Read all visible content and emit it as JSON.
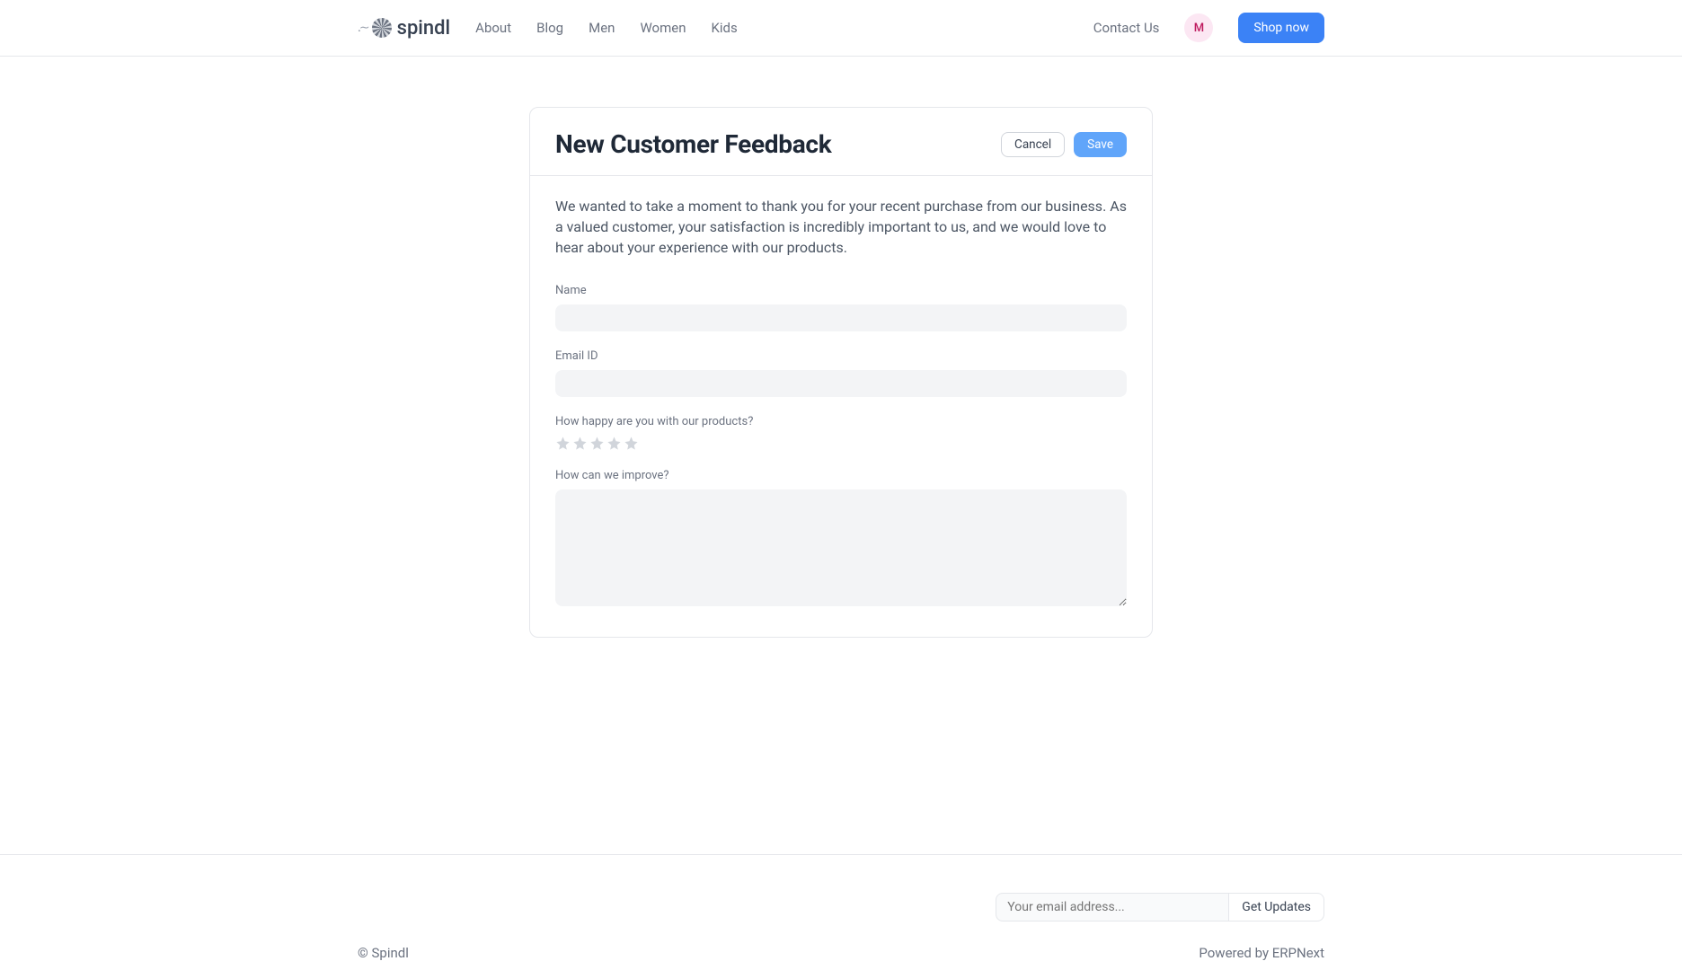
{
  "brand": {
    "name": "spindl"
  },
  "nav": {
    "items": [
      {
        "label": "About"
      },
      {
        "label": "Blog"
      },
      {
        "label": "Men"
      },
      {
        "label": "Women"
      },
      {
        "label": "Kids"
      }
    ],
    "contact": "Contact Us",
    "avatar_initial": "M",
    "shop_now": "Shop now"
  },
  "form": {
    "title": "New Customer Feedback",
    "cancel": "Cancel",
    "save": "Save",
    "intro": "We wanted to take a moment to thank you for your recent purchase from our business. As a valued customer, your satisfaction is incredibly important to us, and we would love to hear about your experience with our products.",
    "fields": {
      "name_label": "Name",
      "name_value": "",
      "email_label": "Email ID",
      "email_value": "",
      "rating_label": "How happy are you with our products?",
      "rating_value": 0,
      "improve_label": "How can we improve?",
      "improve_value": ""
    }
  },
  "footer": {
    "subscribe_placeholder": "Your email address...",
    "subscribe_button": "Get Updates",
    "copyright": "© Spindl",
    "powered": "Powered by ERPNext"
  }
}
